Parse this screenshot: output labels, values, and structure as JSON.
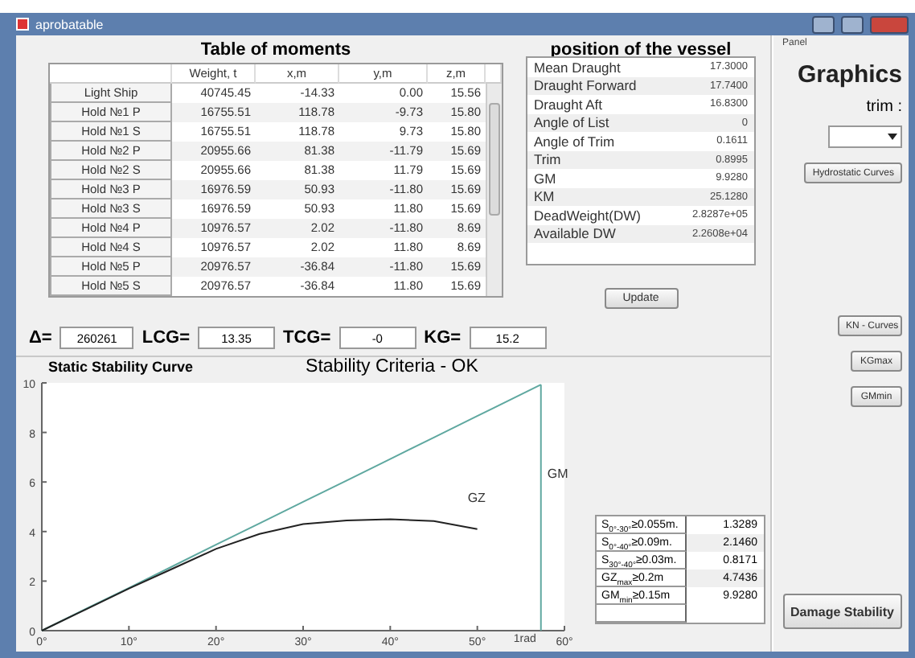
{
  "window": {
    "title": "aprobatable"
  },
  "moments": {
    "title": "Table of moments",
    "columns": [
      "Weight, t",
      "x,m",
      "y,m",
      "z,m"
    ],
    "rows": [
      {
        "name": "Light Ship",
        "values": [
          "40745.45",
          "-14.33",
          "0.00",
          "15.56"
        ]
      },
      {
        "name": "Hold №1 P",
        "values": [
          "16755.51",
          "118.78",
          "-9.73",
          "15.80"
        ]
      },
      {
        "name": "Hold №1 S",
        "values": [
          "16755.51",
          "118.78",
          "9.73",
          "15.80"
        ]
      },
      {
        "name": "Hold №2 P",
        "values": [
          "20955.66",
          "81.38",
          "-11.79",
          "15.69"
        ]
      },
      {
        "name": "Hold №2 S",
        "values": [
          "20955.66",
          "81.38",
          "11.79",
          "15.69"
        ]
      },
      {
        "name": "Hold №3 P",
        "values": [
          "16976.59",
          "50.93",
          "-11.80",
          "15.69"
        ]
      },
      {
        "name": "Hold №3 S",
        "values": [
          "16976.59",
          "50.93",
          "11.80",
          "15.69"
        ]
      },
      {
        "name": "Hold №4 P",
        "values": [
          "10976.57",
          "2.02",
          "-11.80",
          "8.69"
        ]
      },
      {
        "name": "Hold №4 S",
        "values": [
          "10976.57",
          "2.02",
          "11.80",
          "8.69"
        ]
      },
      {
        "name": "Hold №5 P",
        "values": [
          "20976.57",
          "-36.84",
          "-11.80",
          "15.69"
        ]
      },
      {
        "name": "Hold №5 S",
        "values": [
          "20976.57",
          "-36.84",
          "11.80",
          "15.69"
        ]
      }
    ]
  },
  "position": {
    "title": "position of the vessel",
    "rows": [
      {
        "label": "Mean Draught",
        "value": "17.3000"
      },
      {
        "label": "Draught Forward",
        "value": "17.7400"
      },
      {
        "label": "Draught Aft",
        "value": "16.8300"
      },
      {
        "label": "Angle of List",
        "value": "0"
      },
      {
        "label": "Angle of Trim",
        "value": "0.1611"
      },
      {
        "label": "Trim",
        "value": "0.8995"
      },
      {
        "label": "GM",
        "value": "9.9280"
      },
      {
        "label": "KM",
        "value": "25.1280"
      },
      {
        "label": "DeadWeight(DW)",
        "value": "2.8287e+05"
      },
      {
        "label": "Available DW",
        "value": "2.2608e+04"
      }
    ]
  },
  "update_button": "Update",
  "summary": [
    {
      "label": "Δ=",
      "value": "260261"
    },
    {
      "label": "LCG=",
      "value": "13.35"
    },
    {
      "label": "TCG=",
      "value": "-0"
    },
    {
      "label": "KG=",
      "value": "15.2"
    }
  ],
  "chart": {
    "title": "Static Stability Curve",
    "status": "Stability Criteria - OK",
    "chart_data": {
      "type": "line",
      "x": [
        0,
        5,
        10,
        15,
        20,
        25,
        30,
        35,
        40,
        45,
        50,
        57.3
      ],
      "series": [
        {
          "name": "GM",
          "color": "#5fa8a0",
          "values": [
            0,
            0.87,
            1.73,
            2.6,
            3.47,
            4.33,
            5.2,
            6.06,
            6.93,
            7.8,
            8.66,
            9.93
          ]
        },
        {
          "name": "GZ",
          "color": "#222222",
          "values": [
            0,
            0.85,
            1.7,
            2.5,
            3.3,
            3.9,
            4.3,
            4.45,
            4.5,
            4.42,
            4.1,
            null
          ]
        }
      ],
      "xlim": [
        0,
        60
      ],
      "ylim": [
        0,
        10
      ],
      "xticks": [
        {
          "value": 0,
          "label": "0°"
        },
        {
          "value": 10,
          "label": "10°"
        },
        {
          "value": 20,
          "label": "20°"
        },
        {
          "value": 30,
          "label": "30°"
        },
        {
          "value": 40,
          "label": "40°"
        },
        {
          "value": 50,
          "label": "50°"
        },
        {
          "value": 60,
          "label": "60°"
        }
      ],
      "yticks": [
        0,
        2,
        4,
        6,
        8,
        10
      ],
      "ref_lines": [
        {
          "axis": "x",
          "value": 57.3,
          "label": "1rad"
        }
      ]
    }
  },
  "criteria": [
    {
      "label": "S$_{0°-30°}$≥0.055m.",
      "value": "1.3289"
    },
    {
      "label": "S$_{0°-40°}$≥0.09m.",
      "value": "2.1460"
    },
    {
      "label": "S$_{30°-40°}$≥0.03m.",
      "value": "0.8171"
    },
    {
      "label": "GZ$_{max}$≥0.2m",
      "value": "4.7436"
    },
    {
      "label": "GM$_{min}$≥0.15m",
      "value": "9.9280"
    }
  ],
  "panel": {
    "label": "Panel",
    "title": "Graphics",
    "trim_label": "trim :",
    "top_buttons": [
      "Hydrostatic Curves"
    ],
    "mid_buttons": [
      "KN - Curves",
      "KGmax",
      "GMmin"
    ],
    "damage_button": "Damage Stability"
  }
}
